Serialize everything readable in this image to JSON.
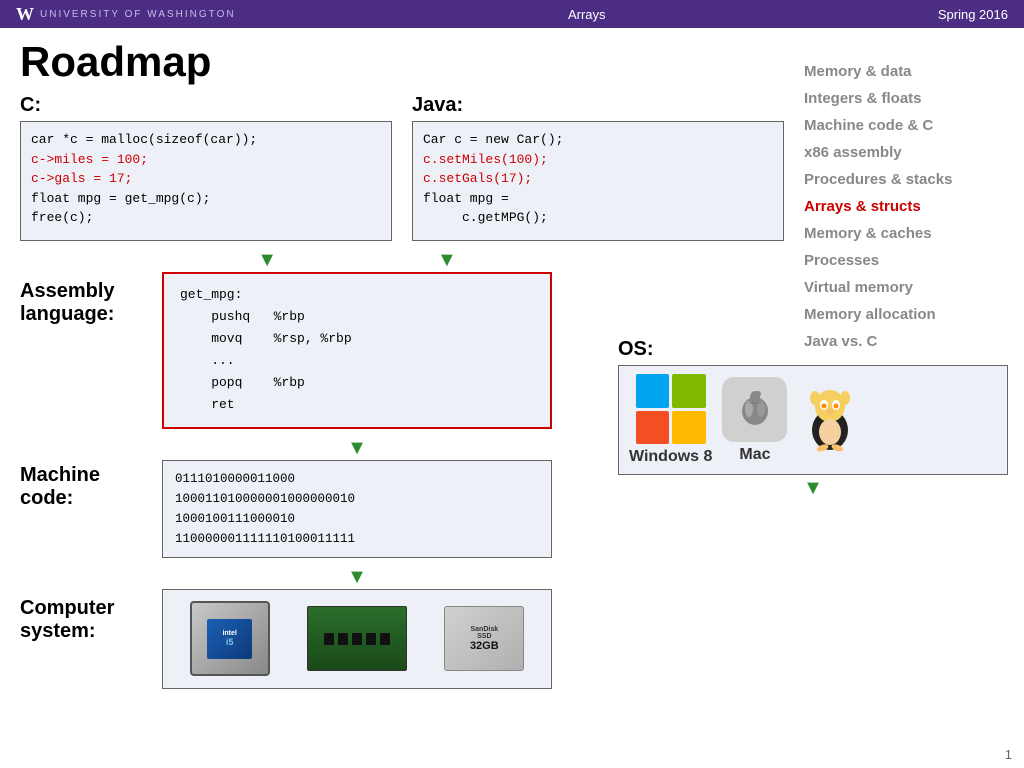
{
  "header": {
    "logo_w": "W",
    "logo_text": "UNIVERSITY of WASHINGTON",
    "title": "Arrays",
    "semester": "Spring 2016"
  },
  "page": {
    "title": "Roadmap",
    "number": "1"
  },
  "c_section": {
    "label": "C:",
    "code_lines": [
      {
        "text": "car *c = malloc(sizeof(car));",
        "color": "black"
      },
      {
        "text": "c->miles = 100;",
        "color": "red"
      },
      {
        "text": "c->gals = 17;",
        "color": "red"
      },
      {
        "text": "float mpg = get_mpg(c);",
        "color": "black"
      },
      {
        "text": "free(c);",
        "color": "black"
      }
    ]
  },
  "java_section": {
    "label": "Java:",
    "code_lines": [
      {
        "text": "Car c = new Car();",
        "color": "black"
      },
      {
        "text": "c.setMiles(100);",
        "color": "red"
      },
      {
        "text": "c.setGals(17);",
        "color": "red"
      },
      {
        "text": "float mpg =",
        "color": "black"
      },
      {
        "text": "     c.getMPG();",
        "color": "black"
      }
    ]
  },
  "assembly_section": {
    "label": "Assembly\nlanguage:",
    "code_lines": [
      "get_mpg:",
      "    pushq   %rbp",
      "    movq    %rsp, %rbp",
      "    ...",
      "    popq    %rbp",
      "    ret"
    ]
  },
  "machine_section": {
    "label": "Machine\ncode:",
    "code_lines": [
      "0111010000011000",
      "100011010000001000000010",
      "1000100111000010",
      "110000001111110100011111"
    ]
  },
  "computer_section": {
    "label": "Computer\nsystem:"
  },
  "os_section": {
    "label": "OS:",
    "windows_label": "Windows 8",
    "mac_label": "Mac"
  },
  "sidebar": {
    "items": [
      {
        "label": "Memory & data",
        "active": false
      },
      {
        "label": "Integers & floats",
        "active": false
      },
      {
        "label": "Machine code & C",
        "active": false
      },
      {
        "label": "x86 assembly",
        "active": false
      },
      {
        "label": "Procedures & stacks",
        "active": false
      },
      {
        "label": "Arrays & structs",
        "active": true
      },
      {
        "label": "Memory & caches",
        "active": false
      },
      {
        "label": "Processes",
        "active": false
      },
      {
        "label": "Virtual memory",
        "active": false
      },
      {
        "label": "Memory allocation",
        "active": false
      },
      {
        "label": "Java vs. C",
        "active": false
      }
    ]
  }
}
